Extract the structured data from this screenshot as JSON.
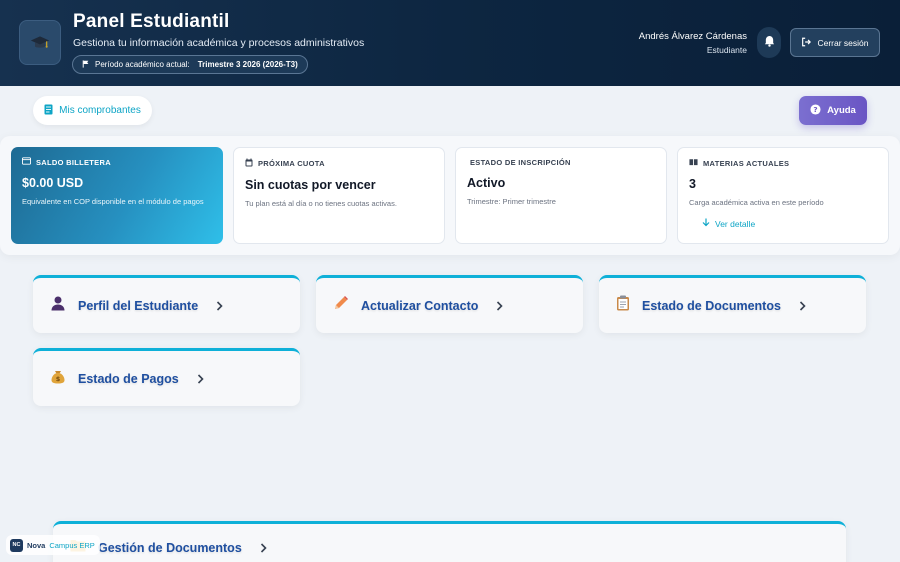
{
  "header": {
    "title": "Panel Estudiantil",
    "subtitle": "Gestiona tu información académica y procesos administrativos",
    "period_label": "Período académico actual:",
    "period_value": "Trimestre 3 2026 (2026-T3)",
    "user_name": "Andrés Álvarez Cárdenas",
    "user_role": "Estudiante",
    "logout_label": "Cerrar sesión"
  },
  "toolbar": {
    "receipts_label": "Mis comprobantes",
    "help_label": "Ayuda"
  },
  "stats": [
    {
      "label": "SALDO BILLETERA",
      "value": "$0.00 USD",
      "desc": "Equivalente en COP disponible en el módulo de pagos",
      "icon": "wallet-icon"
    },
    {
      "label": "PRÓXIMA CUOTA",
      "value": "Sin cuotas por vencer",
      "desc": "Tu plan está al día o no tienes cuotas activas.",
      "icon": "calendar-icon"
    },
    {
      "label": "ESTADO DE INSCRIPCIÓN",
      "value": "Activo",
      "desc": "Trimestre: Primer trimestre",
      "icon": ""
    },
    {
      "label": "MATERIAS ACTUALES",
      "value": "3",
      "desc": "Carga académica activa en este período",
      "icon": "book-icon",
      "link": "Ver detalle"
    }
  ],
  "modules": [
    {
      "title": "Perfil del Estudiante",
      "icon": "student-icon"
    },
    {
      "title": "Actualizar Contacto",
      "icon": "pencil-icon"
    },
    {
      "title": "Estado de Documentos",
      "icon": "clipboard-icon"
    },
    {
      "title": "Estado de Pagos",
      "icon": "money-bag-icon"
    },
    {
      "title": "Gestión de Documentos",
      "icon": "folder-icon"
    }
  ],
  "brand": {
    "badge": "NC",
    "name_a": "Nova",
    "name_b": "Campus ERP"
  },
  "colors": {
    "accent": "#0eb0d8",
    "header_bg": "#0d2641",
    "module_title": "#1f4fa0",
    "help_button": "#6a55c4"
  }
}
